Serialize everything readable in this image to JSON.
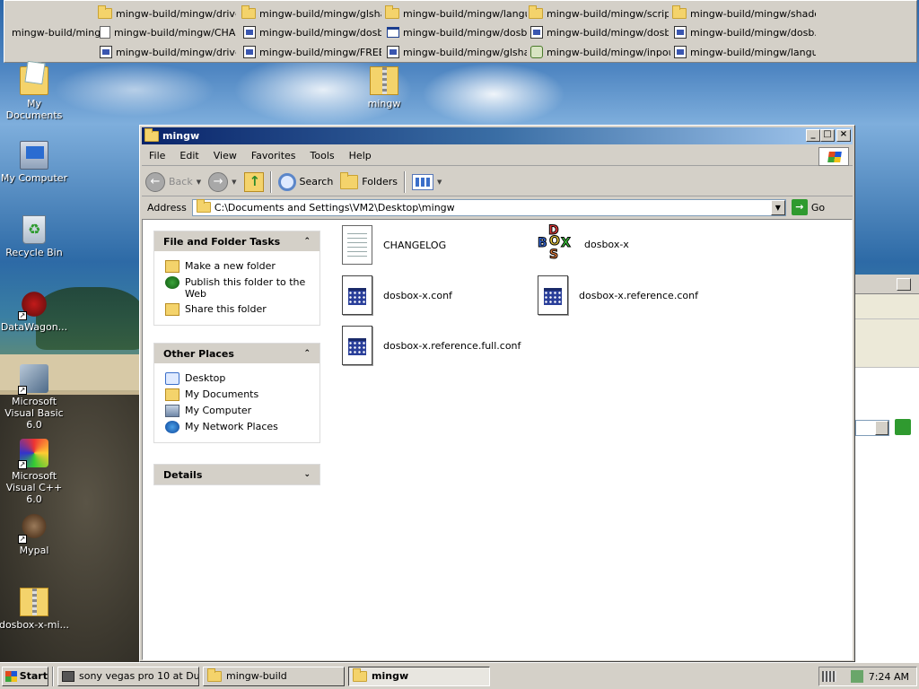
{
  "top_toolbar": {
    "title": "mingw-build/mingw",
    "items": [
      {
        "label": "mingw-build/mingw/drivez",
        "icon": "folder-icon"
      },
      {
        "label": "mingw-build/mingw/glsha...",
        "icon": "folder-icon"
      },
      {
        "label": "mingw-build/mingw/langu...",
        "icon": "folder-icon"
      },
      {
        "label": "mingw-build/mingw/scripts",
        "icon": "folder-icon"
      },
      {
        "label": "mingw-build/mingw/shaders",
        "icon": "folder-icon"
      },
      {
        "label": "mingw-build/mingw/CHA...",
        "icon": "text-file-icon"
      },
      {
        "label": "mingw-build/mingw/dosb...",
        "icon": "conf-file-icon"
      },
      {
        "label": "mingw-build/mingw/dosb...",
        "icon": "window-app-icon"
      },
      {
        "label": "mingw-build/mingw/dosb...",
        "icon": "conf-file-icon"
      },
      {
        "label": "mingw-build/mingw/dosb...",
        "icon": "conf-file-icon"
      },
      {
        "label": "mingw-build/mingw/drivez",
        "icon": "conf-file-icon"
      },
      {
        "label": "mingw-build/mingw/FREE...",
        "icon": "conf-file-icon"
      },
      {
        "label": "mingw-build/mingw/glsha...",
        "icon": "conf-file-icon"
      },
      {
        "label": "mingw-build/mingw/inpou...",
        "icon": "gear-file-icon"
      },
      {
        "label": "mingw-build/mingw/langu...",
        "icon": "conf-file-icon"
      }
    ]
  },
  "desktop_icons": [
    {
      "label": "My Documents",
      "icon": "my-documents-icon"
    },
    {
      "label": "My Computer",
      "icon": "my-computer-icon"
    },
    {
      "label": "Recycle Bin",
      "icon": "recycle-bin-icon"
    },
    {
      "label": "DataWagon...",
      "icon": "datawagon-icon"
    },
    {
      "label": "Microsoft Visual Basic 6.0",
      "icon": "visual-basic-icon"
    },
    {
      "label": "Microsoft Visual C++ 6.0",
      "icon": "visual-cpp-icon"
    },
    {
      "label": "Mypal",
      "icon": "mypal-icon"
    },
    {
      "label": "dosbox-x-mi...",
      "icon": "zip-folder-icon"
    },
    {
      "label": "mingw",
      "icon": "folder-icon"
    }
  ],
  "window": {
    "title": "mingw",
    "menu": [
      "File",
      "Edit",
      "View",
      "Favorites",
      "Tools",
      "Help"
    ],
    "toolbar": {
      "back": "Back",
      "search": "Search",
      "folders": "Folders"
    },
    "address": {
      "label": "Address",
      "value": "C:\\Documents and Settings\\VM2\\Desktop\\mingw",
      "go": "Go"
    },
    "taskpane": {
      "file_tasks": {
        "title": "File and Folder Tasks",
        "links": [
          "Make a new folder",
          "Publish this folder to the Web",
          "Share this folder"
        ]
      },
      "other_places": {
        "title": "Other Places",
        "links": [
          "Desktop",
          "My Documents",
          "My Computer",
          "My Network Places"
        ]
      },
      "details": {
        "title": "Details"
      }
    },
    "files": [
      {
        "name": "CHANGELOG",
        "icon": "text-document-icon"
      },
      {
        "name": "dosbox-x",
        "icon": "dosbox-app-icon"
      },
      {
        "name": "dosbox-x.conf",
        "icon": "config-file-icon"
      },
      {
        "name": "dosbox-x.reference.conf",
        "icon": "config-file-icon"
      },
      {
        "name": "dosbox-x.reference.full.conf",
        "icon": "config-file-icon"
      }
    ]
  },
  "taskbar": {
    "start": "Start",
    "tasks": [
      {
        "label": "sony vegas pro 10 at Du...",
        "active": false
      },
      {
        "label": "mingw-build",
        "active": false
      },
      {
        "label": "mingw",
        "active": true
      }
    ],
    "clock": "7:24 AM"
  }
}
